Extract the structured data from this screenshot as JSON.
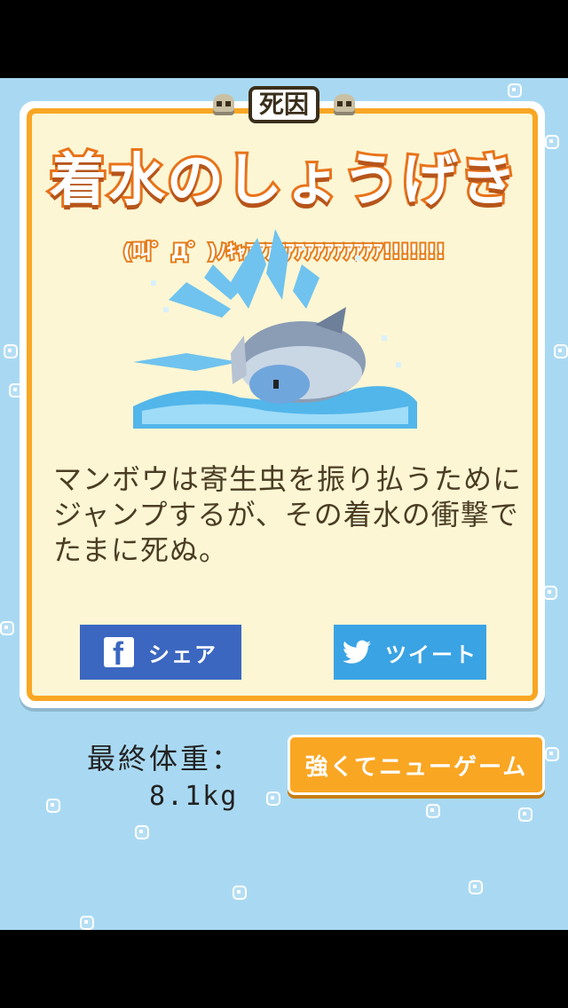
{
  "cause": {
    "label": "死因",
    "title": "着水のしょうげき",
    "shout": "(叫゜Д゜)ﾉｷｬｱｱｱｱｱｱｱｱｱｱｱｱｱｱ!!!!!!!",
    "description": "マンボウは寄生虫を振り払うためにジャンプするが、その着水の衝撃でたまに死ぬ。"
  },
  "share": {
    "facebook_label": "シェア",
    "twitter_label": "ツイート"
  },
  "result": {
    "weight_label": "最終体重：",
    "weight_value": "8.1kg"
  },
  "new_game_label": "強くてニューゲーム",
  "colors": {
    "background": "#a9d9f2",
    "card_border": "#f9a623",
    "card_fill": "#fcf6d4",
    "facebook": "#3b67c0",
    "twitter": "#3aa3e4",
    "title_stroke": "#e8731a"
  }
}
